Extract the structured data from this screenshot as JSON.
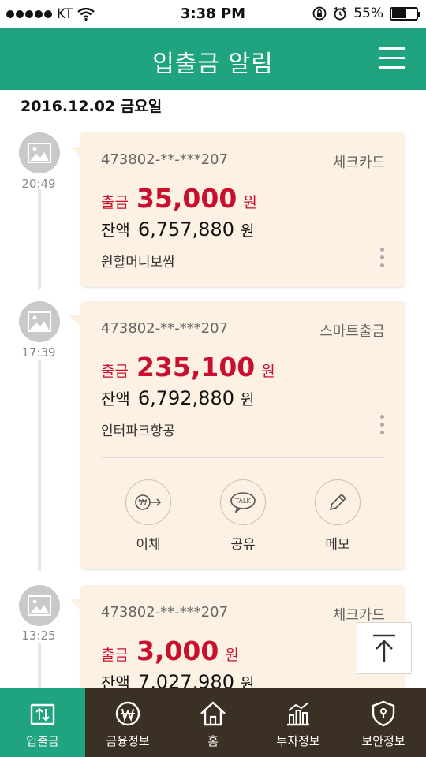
{
  "status_bar": {
    "carrier": "KT",
    "time": "3:38 PM",
    "battery_text": "55%"
  },
  "header": {
    "title": "입출금 알림"
  },
  "date_label": "2016.12.02 금요일",
  "transactions": [
    {
      "time": "20:49",
      "account": "473802-**-***207",
      "kind": "체크카드",
      "amount_label": "출금",
      "amount": "35,000",
      "amount_unit": "원",
      "balance_label": "잔액",
      "balance": "6,757,880",
      "balance_unit": "원",
      "merchant": "원할머니보쌈"
    },
    {
      "time": "17:39",
      "account": "473802-**-***207",
      "kind": "스마트출금",
      "amount_label": "출금",
      "amount": "235,100",
      "amount_unit": "원",
      "balance_label": "잔액",
      "balance": "6,792,880",
      "balance_unit": "원",
      "merchant": "인터파크항공",
      "actions": [
        {
          "label": "이체",
          "icon": "won-transfer-icon"
        },
        {
          "label": "공유",
          "icon": "talk-bubble-icon"
        },
        {
          "label": "메모",
          "icon": "pencil-icon"
        }
      ]
    },
    {
      "time": "13:25",
      "account": "473802-**-***207",
      "kind": "체크카드",
      "amount_label": "출금",
      "amount": "3,000",
      "amount_unit": "원",
      "balance_label": "잔액",
      "balance": "7,027,980",
      "balance_unit": "원"
    }
  ],
  "bottom_nav": [
    {
      "label": "입출금",
      "icon": "inout-icon",
      "active": true
    },
    {
      "label": "금융정보",
      "icon": "won-circle-icon",
      "active": false
    },
    {
      "label": "홈",
      "icon": "home-icon",
      "active": false
    },
    {
      "label": "투자정보",
      "icon": "chart-icon",
      "active": false
    },
    {
      "label": "보안정보",
      "icon": "shield-icon",
      "active": false
    }
  ],
  "colors": {
    "brand": "#1fa47f",
    "card_bg": "#fdf1e4",
    "withdraw": "#c8102e",
    "nav_bg": "#3a3023"
  }
}
